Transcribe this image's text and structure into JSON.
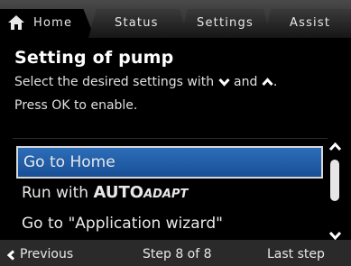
{
  "tabs": {
    "home_label": "Home",
    "status_label": "Status",
    "settings_label": "Settings",
    "assist_label": "Assist"
  },
  "page": {
    "title": "Setting of pump",
    "instruction_line1_prefix": "Select the desired settings with",
    "instruction_line1_middle": "and",
    "instruction_line1_suffix": ".",
    "instruction_line2": "Press OK to enable.",
    "down_icon": "chevron-down-icon",
    "up_icon": "chevron-up-icon"
  },
  "options": {
    "item1": "Go to Home",
    "item2_prefix": "Run with ",
    "item2_auto": "AUTO",
    "item2_adapt": "ADAPT",
    "item3": "Go to \"Application wizard\""
  },
  "footer": {
    "previous_label": "Previous",
    "step_label": "Step 8 of 8",
    "last_label": "Last step"
  },
  "colors": {
    "selection": "#2d6db8",
    "background": "#000000",
    "tabbar": "#3a3a3a"
  }
}
